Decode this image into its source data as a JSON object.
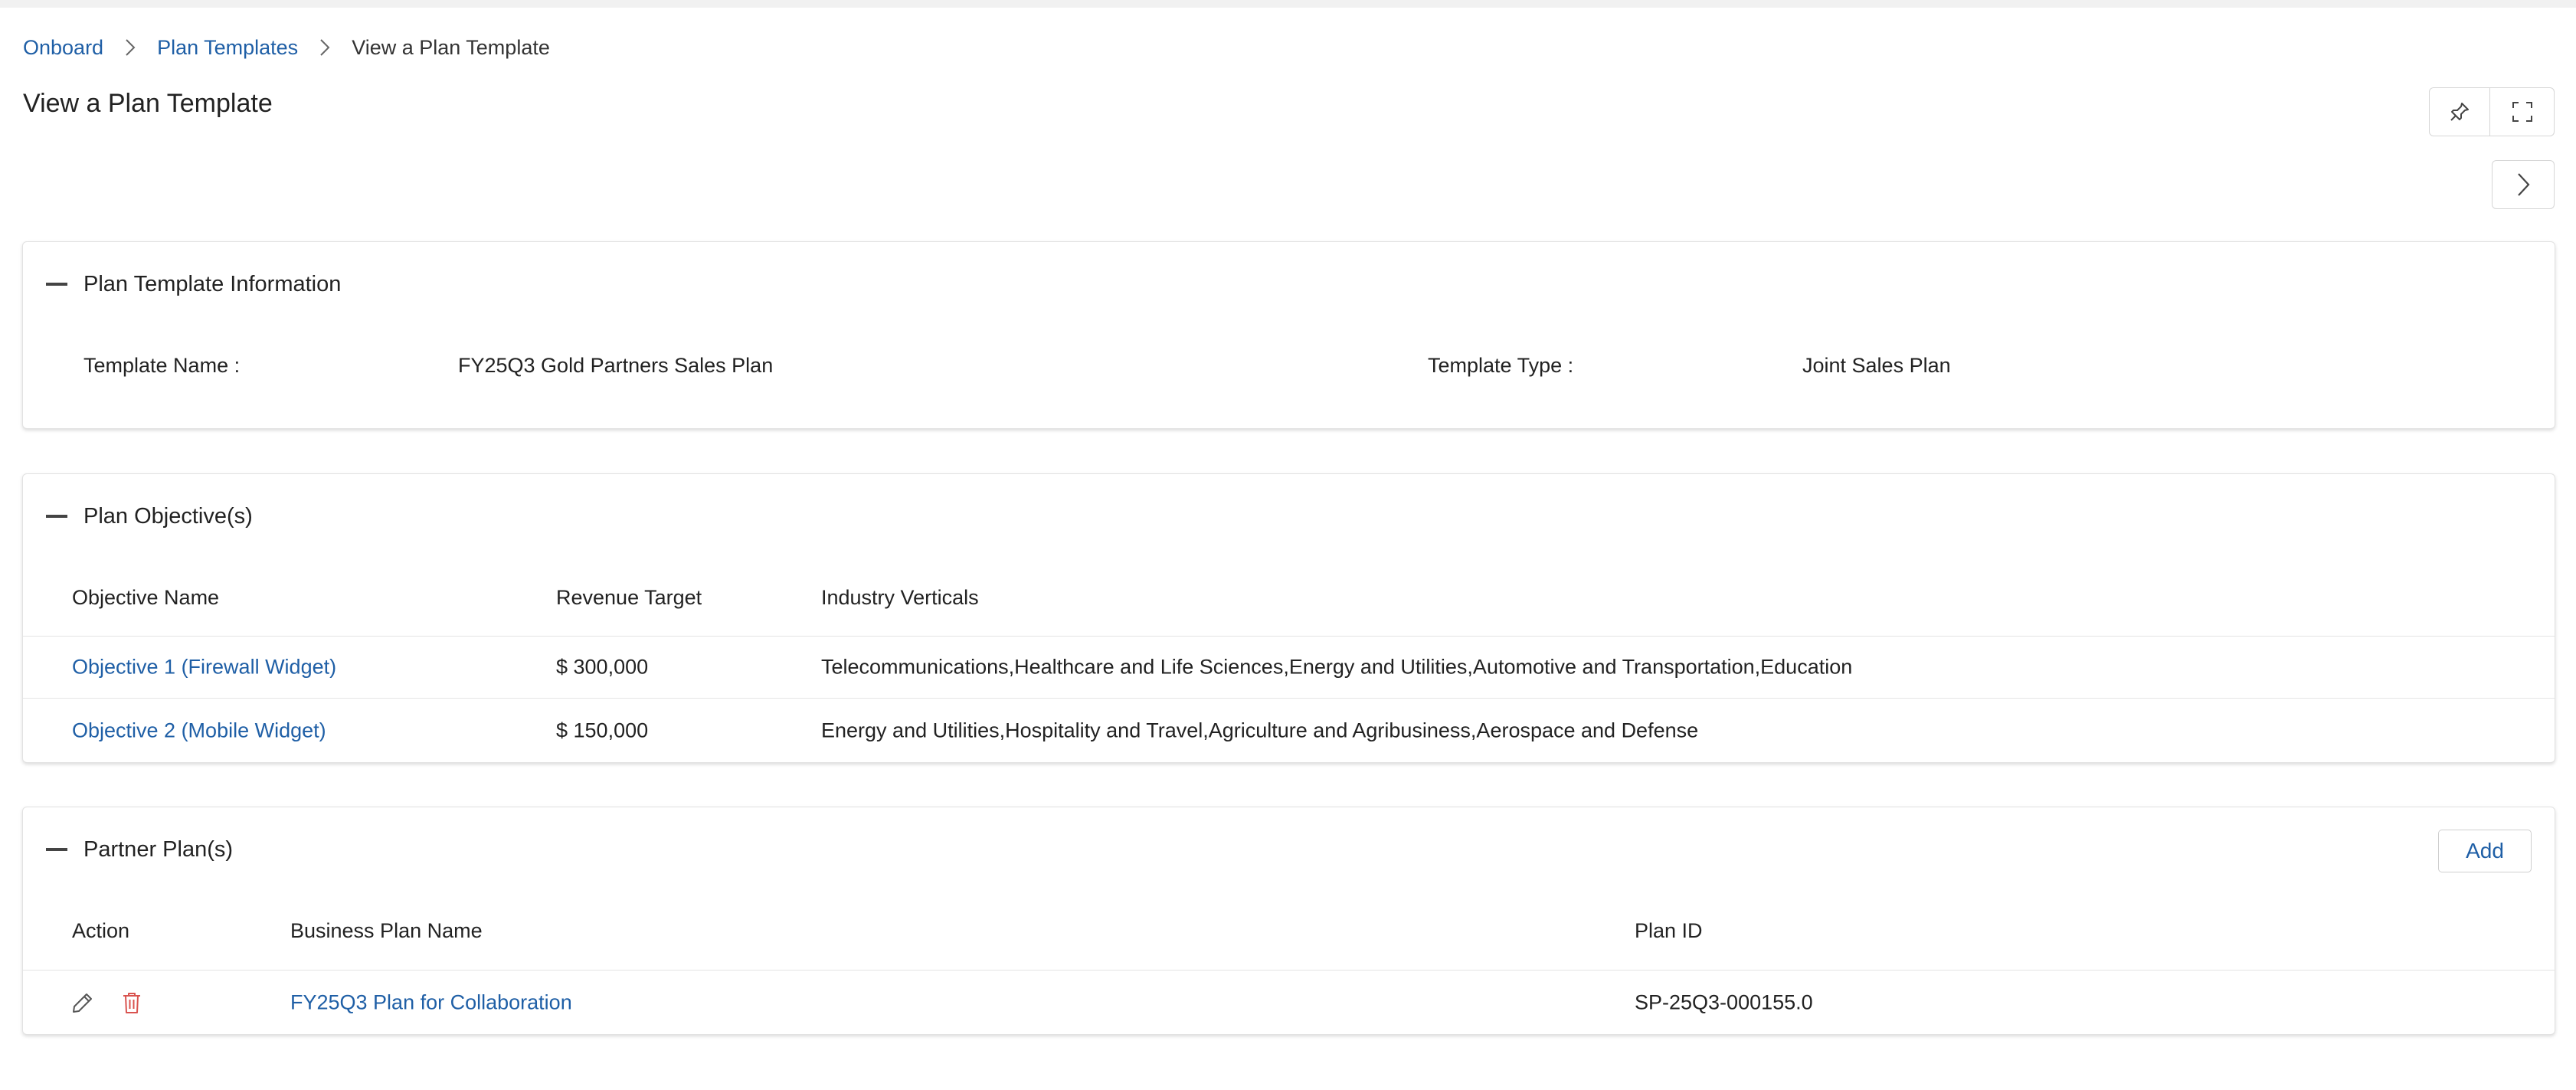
{
  "breadcrumb": {
    "items": [
      {
        "label": "Onboard"
      },
      {
        "label": "Plan Templates"
      },
      {
        "label": "View a Plan Template"
      }
    ]
  },
  "page": {
    "title": "View a Plan Template"
  },
  "toolbar": {
    "pin_icon": "pin-icon",
    "expand_icon": "expand-icon",
    "next_icon": "chevron-right-icon"
  },
  "info": {
    "title": "Plan Template Information",
    "template_name_label": "Template Name :",
    "template_name_value": "FY25Q3 Gold Partners Sales Plan",
    "template_type_label": "Template Type :",
    "template_type_value": "Joint Sales Plan"
  },
  "objectives": {
    "title": "Plan Objective(s)",
    "columns": [
      "Objective Name",
      "Revenue Target",
      "Industry Verticals"
    ],
    "rows": [
      {
        "name": "Objective 1 (Firewall Widget)",
        "revenue": "$ 300,000",
        "verticals": "Telecommunications,Healthcare and Life Sciences,Energy and Utilities,Automotive and Transportation,Education"
      },
      {
        "name": "Objective 2 (Mobile Widget)",
        "revenue": "$ 150,000",
        "verticals": "Energy and Utilities,Hospitality and Travel,Agriculture and Agribusiness,Aerospace and Defense"
      }
    ]
  },
  "partner_plans": {
    "title": "Partner Plan(s)",
    "add_label": "Add",
    "columns": [
      "Action",
      "Business Plan Name",
      "Plan ID"
    ],
    "rows": [
      {
        "name": "FY25Q3 Plan for Collaboration",
        "plan_id": "SP-25Q3-000155.0"
      }
    ]
  },
  "colors": {
    "link": "#1f5fa6",
    "delete_icon": "#d9534f",
    "text": "#222222"
  }
}
